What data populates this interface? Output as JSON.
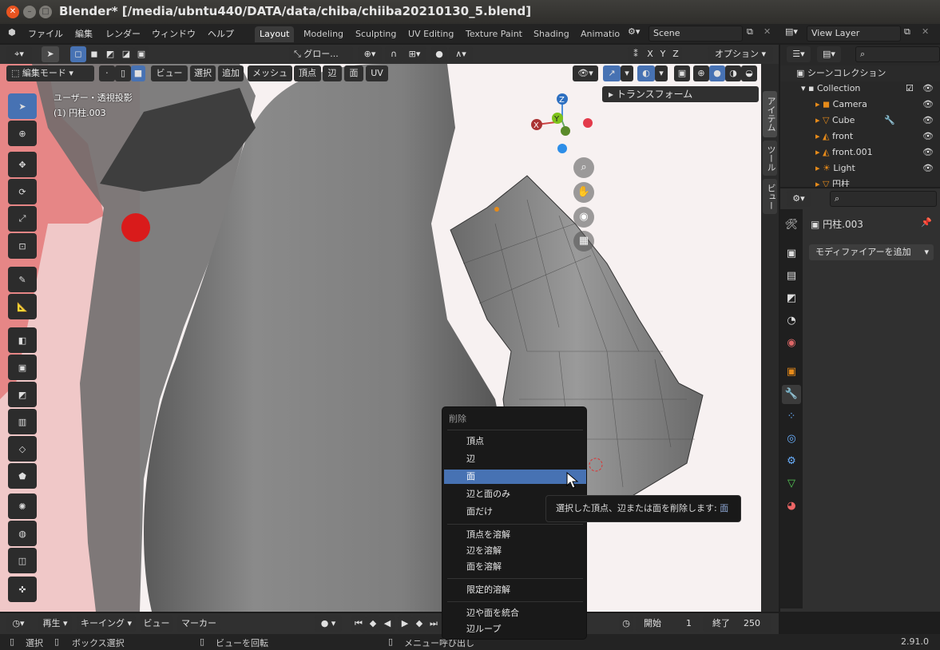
{
  "window": {
    "title": "Blender* [/media/ubntu440/DATA/data/chiba/chiiba20210130_5.blend]"
  },
  "menu": {
    "items": [
      "ファイル",
      "編集",
      "レンダー",
      "ウィンドウ",
      "ヘルプ"
    ]
  },
  "workspaces": [
    "Layout",
    "Modeling",
    "Sculpting",
    "UV Editing",
    "Texture Paint",
    "Shading",
    "Animatio"
  ],
  "scene": {
    "name": "Scene"
  },
  "view_layer": {
    "name": "View Layer"
  },
  "viewport_header": {
    "mode": "編集モード",
    "menus": [
      "ビュー",
      "選択",
      "追加",
      "メッシュ",
      "頂点",
      "辺",
      "面",
      "UV"
    ],
    "transform_orientation": "グロー...",
    "axes": [
      "X",
      "Y",
      "Z"
    ],
    "options": "オプション"
  },
  "viewport": {
    "view_name": "ユーザー・透視投影",
    "object_name": "(1) 円柱.003",
    "gizmo_axes": {
      "x": "X",
      "y": "Y",
      "z": "Z"
    },
    "side_tabs": [
      "アイテム",
      "ツール",
      "ビュー"
    ],
    "transform_panel": "トランスフォーム"
  },
  "outliner": {
    "title": "シーンコレクション",
    "collection": "Collection",
    "objects": [
      "Camera",
      "Cube",
      "front",
      "front.001",
      "Light",
      "円柱"
    ]
  },
  "properties": {
    "object_name": "円柱.003",
    "add_modifier": "モディファイアーを追加"
  },
  "context_menu": {
    "title": "削除",
    "group1": [
      "頂点",
      "辺",
      "面",
      "辺と面のみ",
      "面だけ"
    ],
    "group2": [
      "頂点を溶解",
      "辺を溶解",
      "面を溶解"
    ],
    "group3": [
      "限定的溶解"
    ],
    "group4": [
      "辺や面を統合",
      "辺ループ"
    ],
    "active_item": "面"
  },
  "tooltip": {
    "text": "選択した頂点、辺または面を削除します:",
    "highlight": "面"
  },
  "timeline": {
    "playback": "再生",
    "keying": "キーイング",
    "view": "ビュー",
    "marker": "マーカー",
    "start_label": "開始",
    "start": "1",
    "end_label": "終了",
    "end": "250"
  },
  "statusbar": {
    "select": "選択",
    "box_select": "ボックス選択",
    "rotate_view": "ビューを回転",
    "call_menu": "メニュー呼び出し",
    "version": "2.91.0"
  },
  "colors": {
    "accent": "#4772b3",
    "close": "#e95420"
  }
}
